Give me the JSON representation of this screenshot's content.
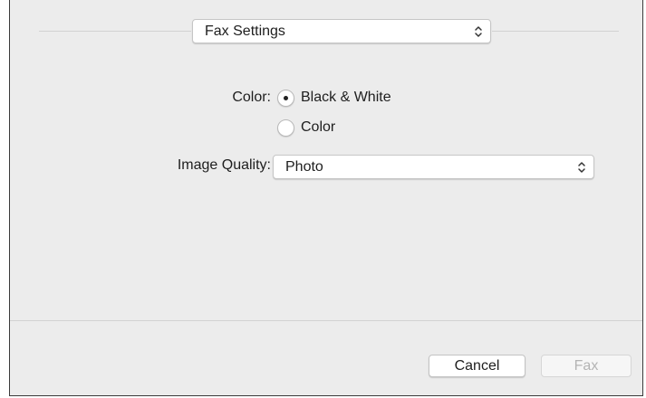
{
  "panel": {
    "selector": {
      "value": "Fax Settings",
      "icon": "up-down-chevron-icon"
    },
    "color_label": "Color:",
    "color_options": [
      {
        "label": "Black & White",
        "selected": true
      },
      {
        "label": "Color",
        "selected": false
      }
    ],
    "image_quality_label": "Image Quality:",
    "image_quality": {
      "value": "Photo",
      "icon": "up-down-chevron-icon"
    }
  },
  "footer": {
    "cancel_label": "Cancel",
    "fax_label": "Fax",
    "fax_enabled": false
  },
  "colors": {
    "background": "#ececec",
    "control": "#ffffff",
    "disabled_text": "#b4b4b4"
  }
}
